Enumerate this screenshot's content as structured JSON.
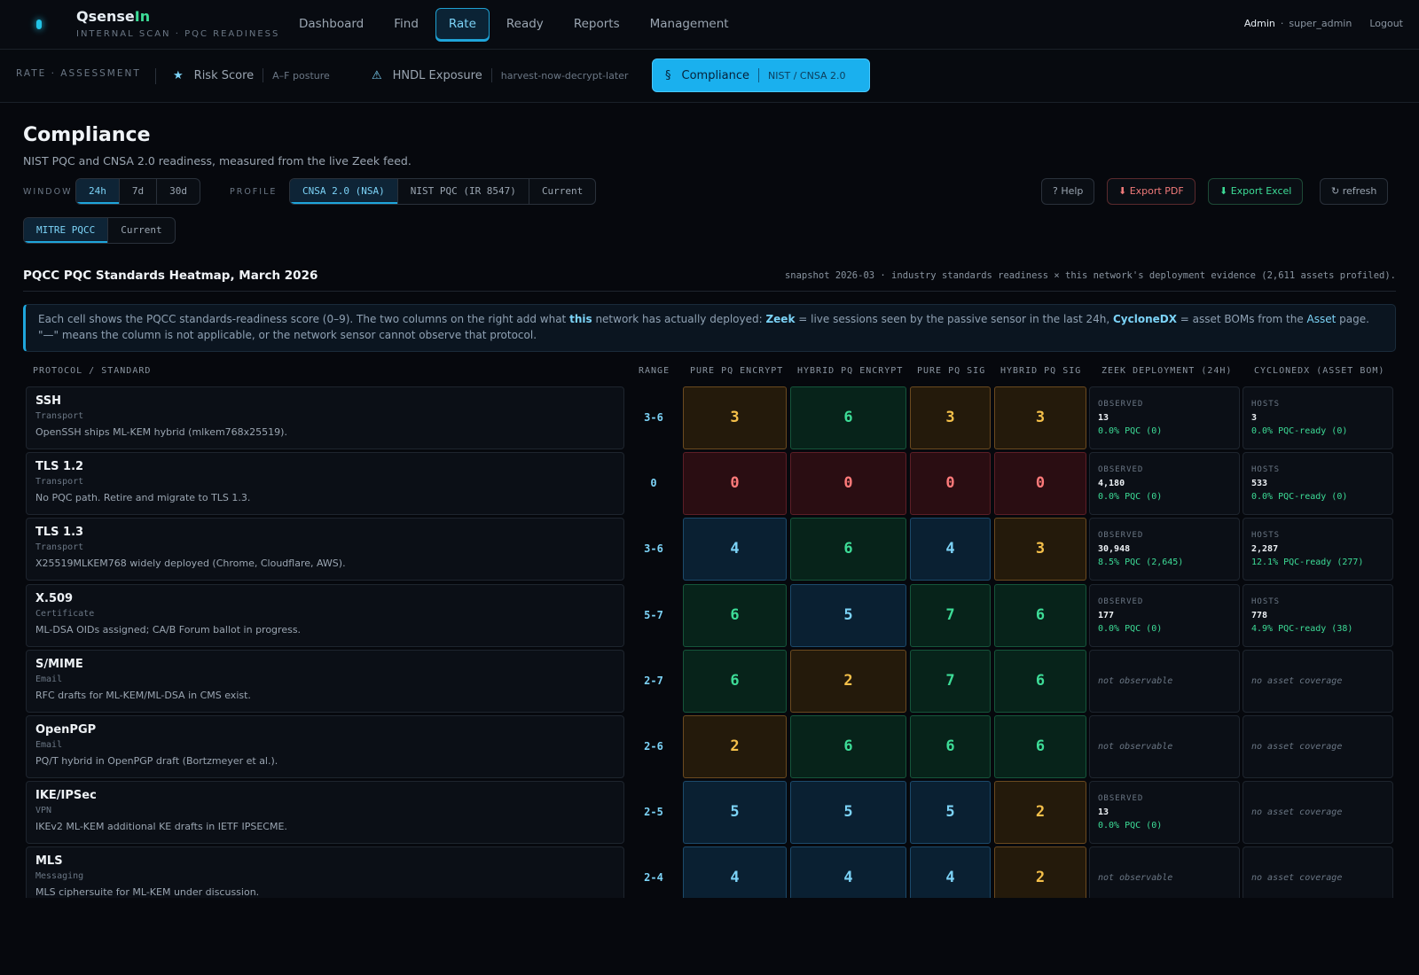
{
  "app": {
    "brand_main": "Qsense",
    "brand_accent": "In",
    "tagline": "INTERNAL SCAN · PQC READINESS",
    "accent_color": "#22c3e6",
    "nav": [
      "Dashboard",
      "Find",
      "Rate",
      "Ready",
      "Reports",
      "Management"
    ],
    "nav_active": "Rate",
    "user": {
      "role": "Admin",
      "separator": "·",
      "name": "super_admin",
      "logout": "Logout"
    }
  },
  "subnav": {
    "label": "RATE · ASSESSMENT",
    "tabs": [
      {
        "icon": "★",
        "label": "Risk Score",
        "sub": "A–F posture"
      },
      {
        "icon": "⚠",
        "label": "HNDL Exposure",
        "sub": "harvest-now-decrypt-later"
      },
      {
        "icon": "§",
        "label": "Compliance",
        "sub": "NIST / CNSA 2.0"
      }
    ],
    "active": "Compliance"
  },
  "page": {
    "title": "Compliance",
    "subtitle": "NIST PQC and CNSA 2.0 readiness, measured from the live Zeek feed."
  },
  "filters": {
    "window_label": "WINDOW",
    "window_options": [
      "24h",
      "7d",
      "30d"
    ],
    "window_active": "24h",
    "profile_label": "PROFILE",
    "profile_options": [
      "CNSA 2.0 (NSA)",
      "NIST PQC (IR 8547)",
      "Current"
    ],
    "profile_active": "CNSA 2.0 (NSA)",
    "framework_options": [
      "MITRE PQCC",
      "Current"
    ],
    "framework_active": "MITRE PQCC"
  },
  "actions": {
    "help": "? Help",
    "export_pdf": "⬇ Export PDF",
    "export_excel": "⬇ Export Excel",
    "refresh": "↻ refresh"
  },
  "section": {
    "title": "PQCC PQC Standards Heatmap, March 2026",
    "meta": "snapshot 2026-03 · industry standards readiness × this network's deployment evidence (2,611 assets profiled)."
  },
  "info": {
    "p1": "Each cell shows the PQCC standards-readiness score (0–9). The two columns on the right add what ",
    "this": "this",
    "p2": " network has actually deployed: ",
    "zeek": "Zeek",
    "p3": " = live sessions seen by the passive sensor in the last 24h, ",
    "cdx": "CycloneDX",
    "p4": " = asset BOMs from the ",
    "asset": "Asset",
    "p5": " page. \"—\" means the column is not applicable, or the network sensor cannot observe that protocol."
  },
  "table": {
    "headers": {
      "protocol": "PROTOCOL / STANDARD",
      "range": "RANGE",
      "pure_enc": "PURE PQ ENCRYPT",
      "hybrid_enc": "HYBRID PQ ENCRYPT",
      "pure_sig": "PURE PQ SIG",
      "hybrid_sig": "HYBRID PQ SIG",
      "zeek": "ZEEK DEPLOYMENT (24H)",
      "cdx": "CYCLONEDX (ASSET BOM)"
    },
    "rows": [
      {
        "name": "SSH",
        "category": "Transport",
        "note": "OpenSSH ships ML-KEM hybrid (mlkem768x25519).",
        "range": "3-6",
        "scores": [
          3,
          6,
          3,
          3
        ],
        "tones": [
          "amber",
          "green",
          "amber",
          "amber"
        ],
        "zeek": {
          "label": "OBSERVED",
          "count": "13",
          "pct": "0.0% PQC (0)"
        },
        "cdx": {
          "label": "HOSTS",
          "count": "3",
          "pct": "0.0% PQC-ready (0)"
        }
      },
      {
        "name": "TLS 1.2",
        "category": "Transport",
        "note": "No PQC path. Retire and migrate to TLS 1.3.",
        "range": "0",
        "scores": [
          0,
          0,
          0,
          0
        ],
        "tones": [
          "red",
          "red",
          "red",
          "red"
        ],
        "zeek": {
          "label": "OBSERVED",
          "count": "4,180",
          "pct": "0.0% PQC (0)"
        },
        "cdx": {
          "label": "HOSTS",
          "count": "533",
          "pct": "0.0% PQC-ready (0)"
        }
      },
      {
        "name": "TLS 1.3",
        "category": "Transport",
        "note": "X25519MLKEM768 widely deployed (Chrome, Cloudflare, AWS).",
        "range": "3-6",
        "scores": [
          4,
          6,
          4,
          3
        ],
        "tones": [
          "blue",
          "green",
          "blue",
          "amber"
        ],
        "zeek": {
          "label": "OBSERVED",
          "count": "30,948",
          "pct": "8.5% PQC (2,645)"
        },
        "cdx": {
          "label": "HOSTS",
          "count": "2,287",
          "pct": "12.1% PQC-ready (277)"
        }
      },
      {
        "name": "X.509",
        "category": "Certificate",
        "note": "ML-DSA OIDs assigned; CA/B Forum ballot in progress.",
        "range": "5-7",
        "scores": [
          6,
          5,
          7,
          6
        ],
        "tones": [
          "green",
          "blue",
          "green",
          "green"
        ],
        "zeek": {
          "label": "OBSERVED",
          "count": "177",
          "pct": "0.0% PQC (0)"
        },
        "cdx": {
          "label": "HOSTS",
          "count": "778",
          "pct": "4.9% PQC-ready (38)"
        }
      },
      {
        "name": "S/MIME",
        "category": "Email",
        "note": "RFC drafts for ML-KEM/ML-DSA in CMS exist.",
        "range": "2-7",
        "scores": [
          6,
          2,
          7,
          6
        ],
        "tones": [
          "green",
          "amber",
          "green",
          "green"
        ],
        "zeek": {
          "na": "not observable"
        },
        "cdx": {
          "na": "no asset coverage"
        }
      },
      {
        "name": "OpenPGP",
        "category": "Email",
        "note": "PQ/T hybrid in OpenPGP draft (Bortzmeyer et al.).",
        "range": "2-6",
        "scores": [
          2,
          6,
          6,
          6
        ],
        "tones": [
          "amber",
          "green",
          "green",
          "green"
        ],
        "zeek": {
          "na": "not observable"
        },
        "cdx": {
          "na": "no asset coverage"
        }
      },
      {
        "name": "IKE/IPSec",
        "category": "VPN",
        "note": "IKEv2 ML-KEM additional KE drafts in IETF IPSECME.",
        "range": "2-5",
        "scores": [
          5,
          5,
          5,
          2
        ],
        "tones": [
          "blue",
          "blue",
          "blue",
          "amber"
        ],
        "zeek": {
          "label": "OBSERVED",
          "count": "13",
          "pct": "0.0% PQC (0)"
        },
        "cdx": {
          "na": "no asset coverage"
        }
      },
      {
        "name": "MLS",
        "category": "Messaging",
        "note": "MLS ciphersuite for ML-KEM under discussion.",
        "range": "2-4",
        "scores": [
          4,
          4,
          4,
          2
        ],
        "tones": [
          "blue",
          "blue",
          "blue",
          "amber"
        ],
        "zeek": {
          "na": "not observable"
        },
        "cdx": {
          "na": "no asset coverage"
        }
      }
    ]
  }
}
